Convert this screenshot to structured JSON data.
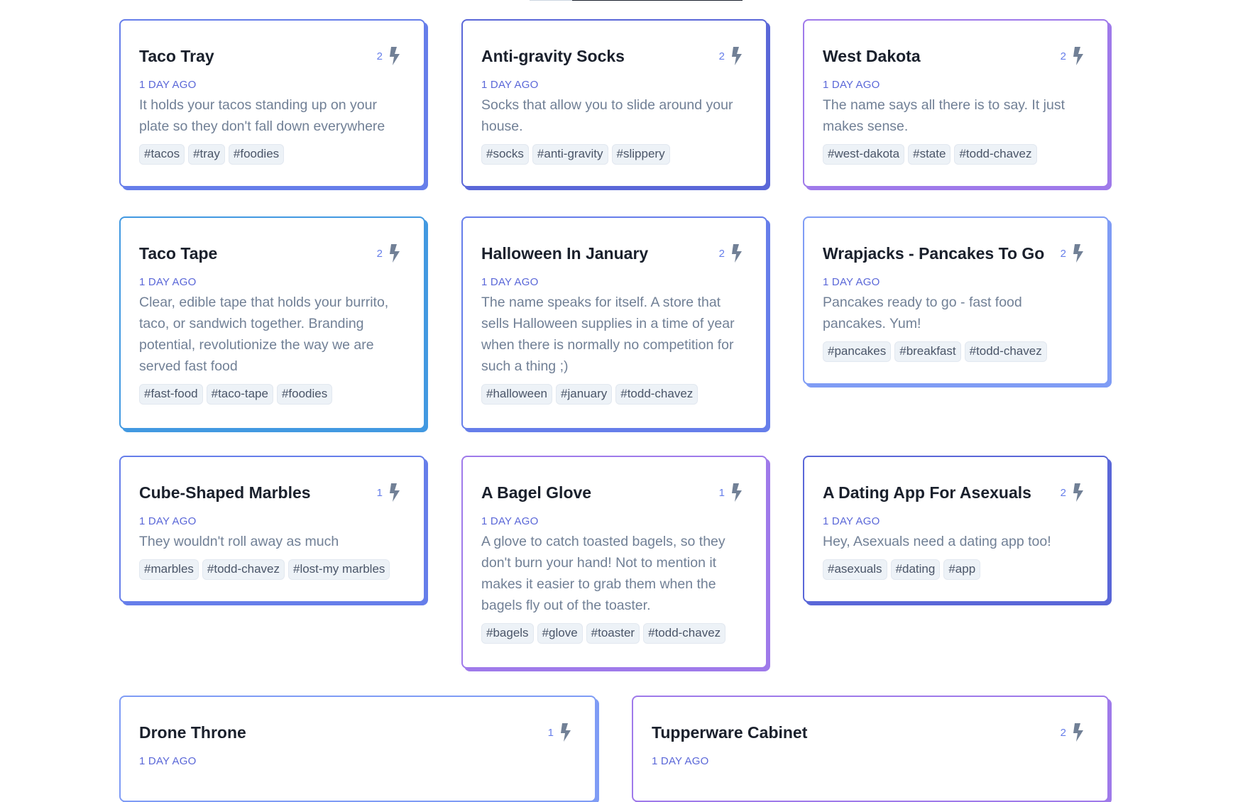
{
  "cards": [
    {
      "title": "Taco Tray",
      "votes": "2",
      "date": "1 day ago",
      "desc": "It holds your tacos standing up on your plate so they don't fall down everywhere",
      "tags": [
        "#tacos",
        "#tray",
        "#foodies"
      ],
      "accent": "#667eea"
    },
    {
      "title": "Anti-gravity Socks",
      "votes": "2",
      "date": "1 day ago",
      "desc": "Socks that allow you to slide around your house.",
      "tags": [
        "#socks",
        "#anti-gravity",
        "#slippery"
      ],
      "accent": "#5a67d8"
    },
    {
      "title": "West Dakota",
      "votes": "2",
      "date": "1 day ago",
      "desc": "The name says all there is to say. It just makes sense.",
      "tags": [
        "#west-dakota",
        "#state",
        "#todd-chavez"
      ],
      "accent": "#9f7aea"
    },
    {
      "title": "Taco Tape",
      "votes": "2",
      "date": "1 day ago",
      "desc": "Clear, edible tape that holds your burrito, taco, or sandwich together. Branding potential, revolutionize the way we are served fast food",
      "tags": [
        "#fast-food",
        "#taco-tape",
        "#foodies"
      ],
      "accent": "#4299e1"
    },
    {
      "title": "Halloween In January",
      "votes": "2",
      "date": "1 day ago",
      "desc": "The name speaks for itself. A store that sells Halloween supplies in a time of year when there is normally no competition for such a thing ;)",
      "tags": [
        "#halloween",
        "#january",
        "#todd-chavez"
      ],
      "accent": "#667eea"
    },
    {
      "title": "Wrapjacks - Pancakes To Go",
      "votes": "2",
      "date": "1 day ago",
      "desc": "Pancakes ready to go - fast food pancakes. Yum!",
      "tags": [
        "#pancakes",
        "#breakfast",
        "#todd-chavez"
      ],
      "accent": "#7f9cf5"
    },
    {
      "title": "Cube-Shaped Marbles",
      "votes": "1",
      "date": "1 day ago",
      "desc": "They wouldn't roll away as much",
      "tags": [
        "#marbles",
        "#todd-chavez",
        "#lost-my marbles"
      ],
      "accent": "#667eea"
    },
    {
      "title": "A Bagel Glove",
      "votes": "1",
      "date": "1 day ago",
      "desc": "A glove to catch toasted bagels, so they don't burn your hand! Not to mention it makes it easier to grab them when the bagels fly out of the toaster.",
      "tags": [
        "#bagels",
        "#glove",
        "#toaster",
        "#todd-chavez"
      ],
      "accent": "#9f7aea"
    },
    {
      "title": "A Dating App For Asexuals",
      "votes": "2",
      "date": "1 day ago",
      "desc": "Hey, Asexuals need a dating app too!",
      "tags": [
        "#asexuals",
        "#dating",
        "#app"
      ],
      "accent": "#5a67d8"
    },
    {
      "title": "Drone Throne",
      "votes": "1",
      "date": "1 day ago",
      "desc": "",
      "tags": [],
      "accent": "#7f9cf5"
    },
    {
      "title": "Tupperware Cabinet",
      "votes": "2",
      "date": "1 day ago",
      "desc": "",
      "tags": [],
      "accent": "#9f7aea"
    }
  ],
  "colors": {
    "bolt": "#718096",
    "vote": "#667eea",
    "date": "#5a67d8"
  }
}
